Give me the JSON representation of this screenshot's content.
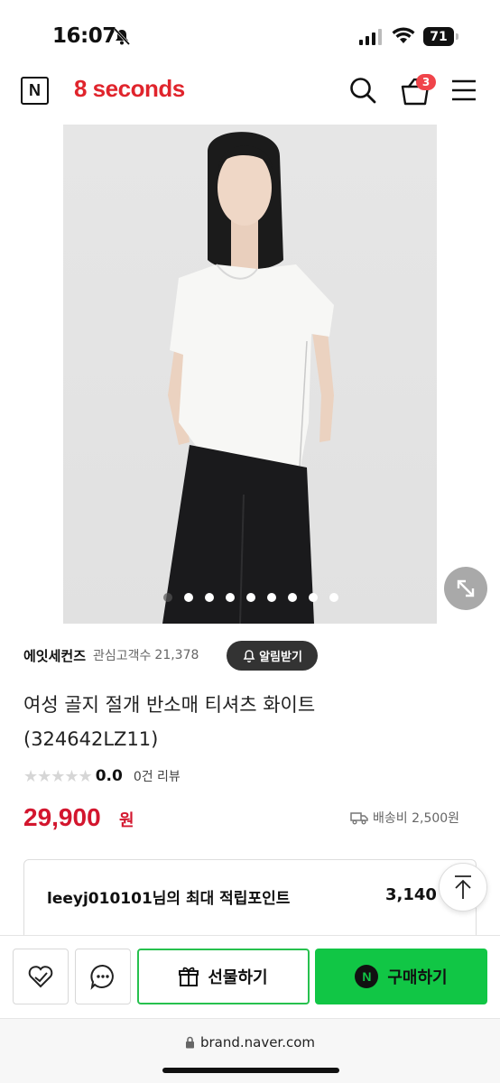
{
  "status_bar": {
    "time": "16:07",
    "battery": "71"
  },
  "header": {
    "logo_letter": "N",
    "brand_logo": "8 seconds",
    "cart_count": "3"
  },
  "product": {
    "image_alt": "Model wearing white asymmetric short-sleeve t-shirt",
    "carousel_total": 9,
    "carousel_active": 0,
    "brand_name": "에잇세컨즈",
    "followers_label": "관심고객수",
    "followers_count": "21,378",
    "alarm_label": "알림받기",
    "title_line1": "여성 골지 절개 반소매 티셔츠 화이트",
    "title_line2": "(324642LZ11)",
    "rating_stars": "★★★★★",
    "rating_score": "0.0",
    "review_count": "0건 리뷰",
    "price": "29,900",
    "price_unit": "원",
    "shipping": "배송비 2,500원"
  },
  "points": {
    "label": "leeyj010101님의 최대 적립포인트",
    "value": "3,140"
  },
  "actions": {
    "gift_label": "선물하기",
    "buy_label": "구매하기",
    "npay_letter": "N"
  },
  "browser": {
    "url": "brand.naver.com"
  },
  "colors": {
    "brand_red": "#e0242c",
    "price_red": "#d3162e",
    "naver_green": "#11c645"
  }
}
